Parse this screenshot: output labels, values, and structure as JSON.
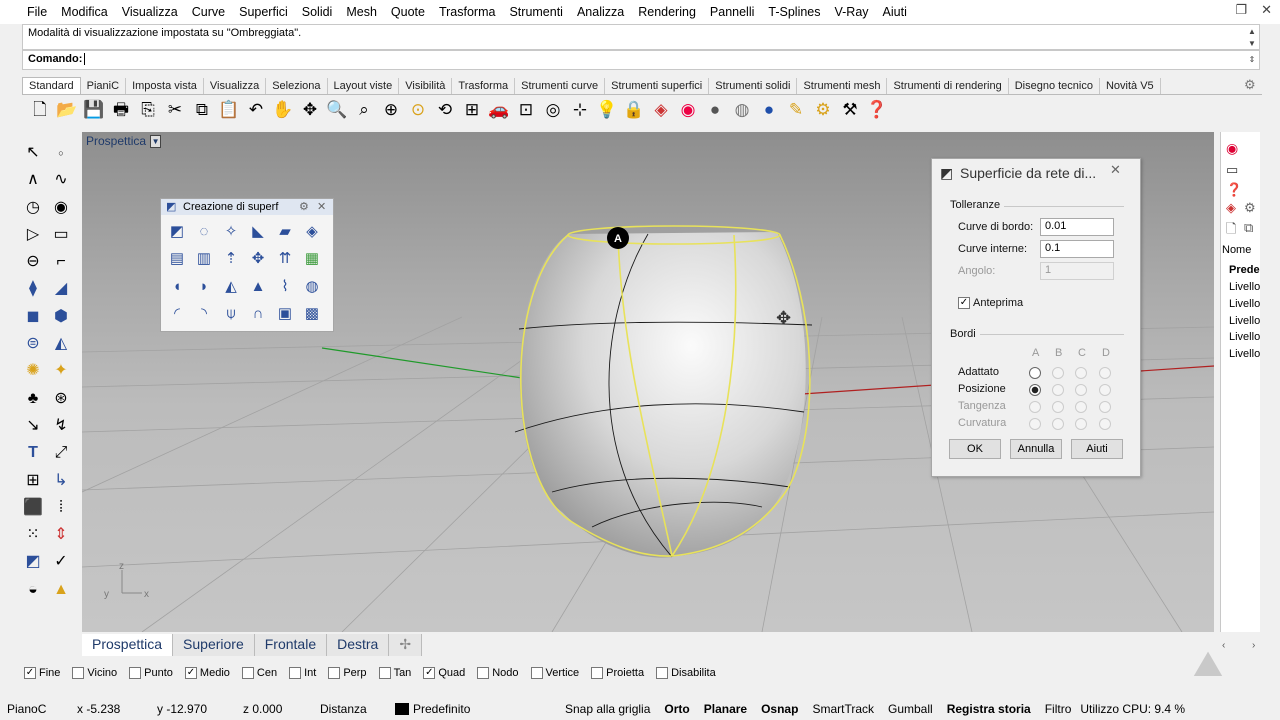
{
  "menu": [
    "File",
    "Modifica",
    "Visualizza",
    "Curve",
    "Superfici",
    "Solidi",
    "Mesh",
    "Quote",
    "Trasforma",
    "Strumenti",
    "Analizza",
    "Rendering",
    "Pannelli",
    "T-Splines",
    "V-Ray",
    "Aiuti"
  ],
  "command": {
    "history": "Modalità di visualizzazione impostata su \"Ombreggiata\".",
    "prompt": "Comando:"
  },
  "toolbar_tabs": [
    "Standard",
    "PianiC",
    "Imposta vista",
    "Visualizza",
    "Seleziona",
    "Layout viste",
    "Visibilità",
    "Trasforma",
    "Strumenti curve",
    "Strumenti superfici",
    "Strumenti solidi",
    "Strumenti mesh",
    "Strumenti di rendering",
    "Disegno tecnico",
    "Novità V5"
  ],
  "viewport": {
    "title": "Prospettica",
    "point_label": "A",
    "axis_x": "x",
    "axis_y": "y",
    "axis_z": "z"
  },
  "palette": {
    "title": "Creazione di superf"
  },
  "dialog": {
    "title": "Superficie da rete di...",
    "tolerances_label": "Tolleranze",
    "edge_curves_label": "Curve di bordo:",
    "edge_curves_value": "0.01",
    "inner_curves_label": "Curve interne:",
    "inner_curves_value": "0.1",
    "angle_label": "Angolo:",
    "angle_value": "1",
    "preview_label": "Anteprima",
    "edges_label": "Bordi",
    "col_headers": [
      "A",
      "B",
      "C",
      "D"
    ],
    "rows": [
      "Adattato",
      "Posizione",
      "Tangenza",
      "Curvatura"
    ],
    "ok": "OK",
    "cancel": "Annulla",
    "help": "Aiuti"
  },
  "right_panel": {
    "name_header": "Nome",
    "items": [
      "Prede",
      "Livello",
      "Livello",
      "Livello",
      "Livello",
      "Livello"
    ]
  },
  "view_tabs": [
    "Prospettica",
    "Superiore",
    "Frontale",
    "Destra"
  ],
  "osnaps": [
    {
      "label": "Fine",
      "checked": true
    },
    {
      "label": "Vicino",
      "checked": false
    },
    {
      "label": "Punto",
      "checked": false
    },
    {
      "label": "Medio",
      "checked": true
    },
    {
      "label": "Cen",
      "checked": false
    },
    {
      "label": "Int",
      "checked": false
    },
    {
      "label": "Perp",
      "checked": false
    },
    {
      "label": "Tan",
      "checked": false
    },
    {
      "label": "Quad",
      "checked": true
    },
    {
      "label": "Nodo",
      "checked": false
    },
    {
      "label": "Vertice",
      "checked": false
    },
    {
      "label": "Proietta",
      "checked": false
    },
    {
      "label": "Disabilita",
      "checked": false
    }
  ],
  "status": {
    "plane": "PianoC",
    "x": "x -5.238",
    "y": "y -12.970",
    "z": "z 0.000",
    "distance": "Distanza",
    "layer": "Predefinito",
    "grid_snap": "Snap alla griglia",
    "ortho": "Orto",
    "planar": "Planare",
    "osnap": "Osnap",
    "smarttrack": "SmartTrack",
    "gumball": "Gumball",
    "history": "Registra storia",
    "filter": "Filtro",
    "cpu": "Utilizzo CPU: 9.4 %"
  }
}
